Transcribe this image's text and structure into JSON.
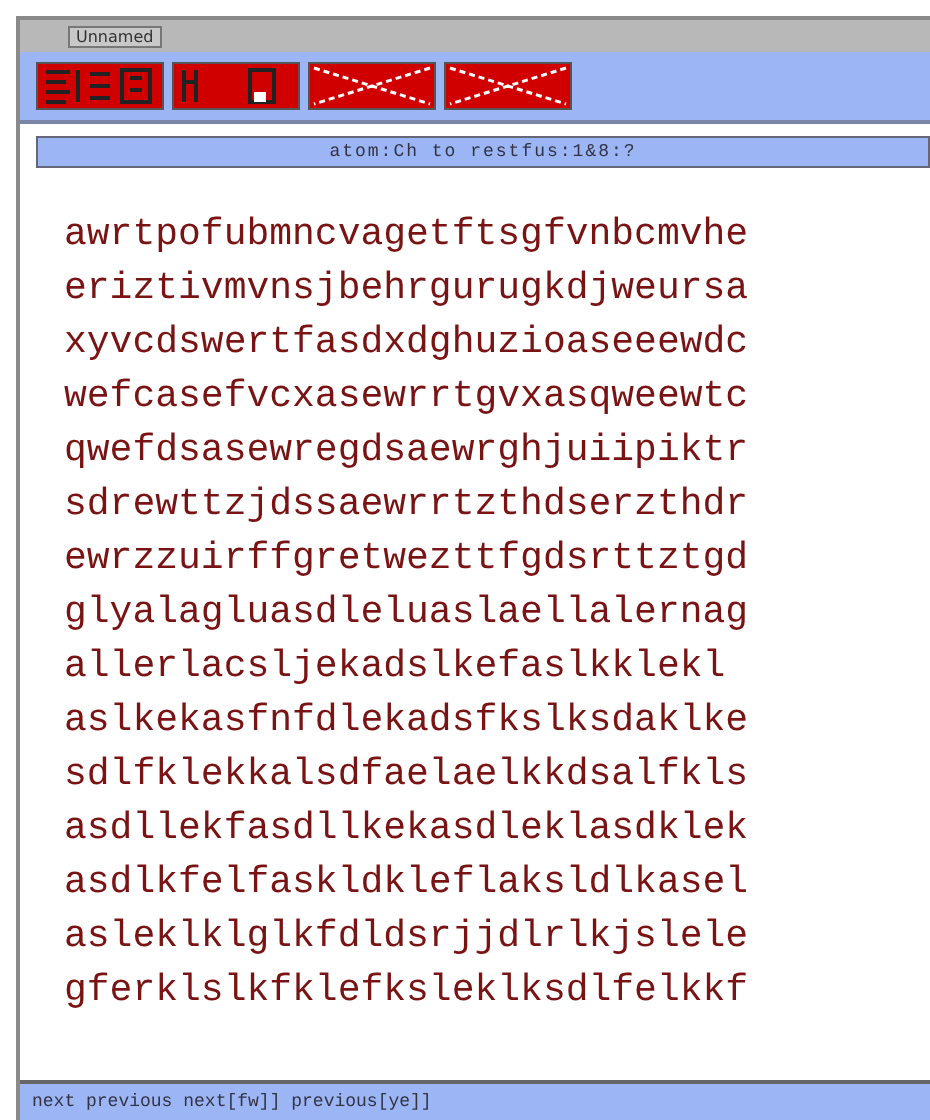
{
  "window": {
    "title": "Unnamed"
  },
  "toolbar": [
    {
      "kind": "glyph"
    },
    {
      "kind": "glyph2"
    },
    {
      "kind": "cross"
    },
    {
      "kind": "cross"
    }
  ],
  "banner": "atom:Ch to restfus:1&8:?",
  "lines": [
    "awrtpofubmncvagetftsgfvnbcmvhe",
    "eriztivmvnsjbehrgurugkdjweursa",
    "xyvcdswertfasdxdghuzioaseeewdc",
    "wefcasefvcxasewrrtgvxasqweewtc",
    "qwefdsasewregdsaewrghjuiipiktr",
    "sdrewttzjdssaewrrtzthdserzthdr",
    "ewrzzuirffgretwezttfgdsrttztgd",
    "glyalagluasdleluaslaellalernag",
    "allerlacsljekadslkefaslkklekl",
    "aslkekasfnfdlekadsfkslksdaklke",
    "sdlfklekkalsdfaelaelkkdsalfkls",
    "asdllekfasdllkekasdleklasdklek",
    "asdlkfelfaskldkleflaksldlkasel",
    "asleklklglkfdldsrjjdlrlkjslele",
    "gferklslkfklefksleklksdlfelkkf"
  ],
  "status": "next previous next[fw]] previous[ye]]"
}
